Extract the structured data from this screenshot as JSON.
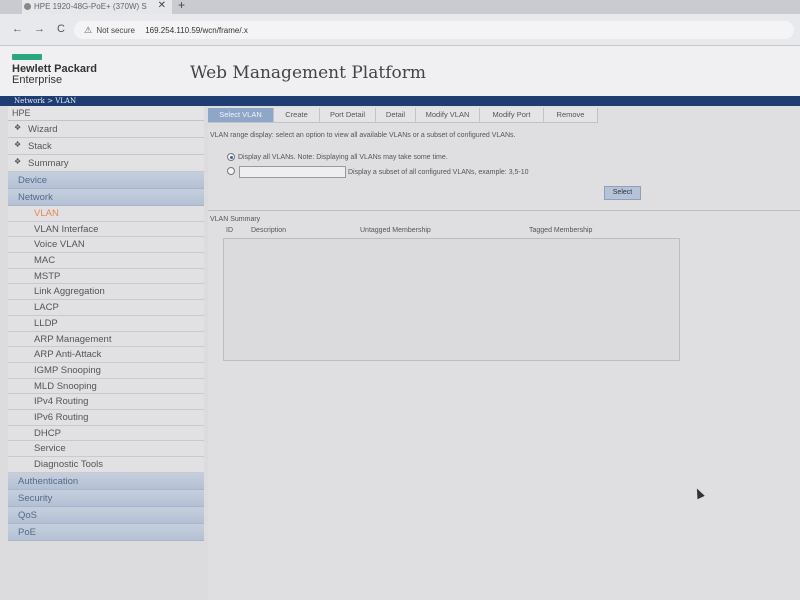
{
  "browser": {
    "tab_title": "HPE 1920-48G-PoE+ (370W) S",
    "tab_close": "✕",
    "new_tab": "+",
    "nav": {
      "back": "←",
      "forward": "→",
      "reload": "C"
    },
    "security_label": "Not secure",
    "url": "169.254.110.59/wcn/frame/.x"
  },
  "header": {
    "logo_line1": "Hewlett Packard",
    "logo_line2": "Enterprise",
    "title": "Web Management Platform",
    "breadcrumb": "Network > VLAN",
    "brand_color": "#2aa77e",
    "bar_color": "#1f3d73"
  },
  "sidebar": {
    "root": "HPE",
    "top_items": [
      {
        "label": "Wizard"
      },
      {
        "label": "Stack"
      },
      {
        "label": "Summary"
      }
    ],
    "bullet": "❖",
    "categories": {
      "device": "Device",
      "network": "Network",
      "authentication": "Authentication",
      "security": "Security",
      "qos": "QoS",
      "poe": "PoE"
    },
    "network_items": [
      "VLAN",
      "VLAN Interface",
      "Voice VLAN",
      "MAC",
      "MSTP",
      "Link Aggregation",
      "LACP",
      "LLDP",
      "ARP Management",
      "ARP Anti-Attack",
      "IGMP Snooping",
      "MLD Snooping",
      "IPv4 Routing",
      "IPv6 Routing",
      "DHCP",
      "Service",
      "Diagnostic Tools"
    ],
    "active_item": "VLAN",
    "active_color": "#e28a4c"
  },
  "tabs": [
    "Select VLAN",
    "Create",
    "Port Detail",
    "Detail",
    "Modify VLAN",
    "Modify Port",
    "Remove"
  ],
  "content": {
    "description": "VLAN range display: select an option to view all available VLANs or a subset of configured VLANs.",
    "option_all": "Display all VLANs. Note: Displaying all VLANs may take some time.",
    "option_subset": "Display a subset of all configured VLANs, example: 3,5-10",
    "range_value": "",
    "select_button": "Select",
    "summary_title": "VLAN Summary",
    "columns": {
      "id": "ID",
      "description": "Description",
      "untagged": "Untagged Membership",
      "tagged": "Tagged Membership"
    }
  }
}
